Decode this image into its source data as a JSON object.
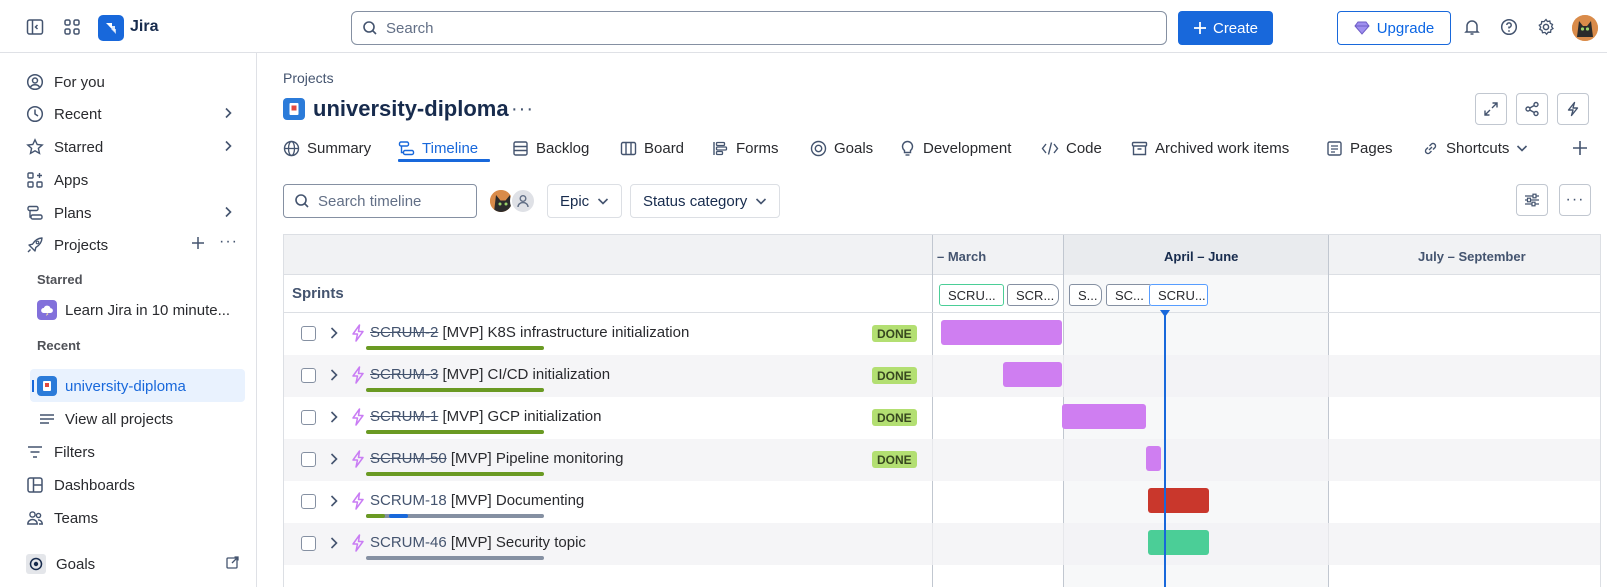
{
  "app": {
    "name": "Jira"
  },
  "top": {
    "search_placeholder": "Search",
    "create_label": "Create",
    "upgrade_label": "Upgrade",
    "brand_color": "#1868db"
  },
  "sidebar": {
    "for_you": "For you",
    "recent": "Recent",
    "starred": "Starred",
    "apps": "Apps",
    "plans": "Plans",
    "projects": "Projects",
    "starred_section": "Starred",
    "starred_project": "Learn Jira in 10 minute...",
    "recent_section": "Recent",
    "recent_project": "university-diploma",
    "view_all": "View all projects",
    "filters": "Filters",
    "dashboards": "Dashboards",
    "teams": "Teams",
    "goals": "Goals"
  },
  "page": {
    "breadcrumb": "Projects",
    "title": "university-diploma"
  },
  "tabs": [
    "Summary",
    "Timeline",
    "Backlog",
    "Board",
    "Forms",
    "Goals",
    "Development",
    "Code",
    "Archived work items",
    "Pages",
    "Shortcuts"
  ],
  "toolbar": {
    "search_placeholder": "Search timeline",
    "epic_label": "Epic",
    "status_label": "Status category"
  },
  "timeline": {
    "months": [
      "– March",
      "April – June",
      "July – September"
    ],
    "current_month": "April – June",
    "sprints_label": "Sprints",
    "sprints": [
      "SCRU...",
      "SCR...",
      "S...",
      "SC...",
      "SCRU..."
    ],
    "items": [
      {
        "key": "SCRUM-2",
        "title": "[MVP] K8S infrastructure initialization",
        "status": "DONE",
        "done": true,
        "bar_color": "#cf7ef1"
      },
      {
        "key": "SCRUM-3",
        "title": "[MVP] CI/CD initialization",
        "status": "DONE",
        "done": true,
        "bar_color": "#cf7ef1"
      },
      {
        "key": "SCRUM-1",
        "title": "[MVP] GCP initialization",
        "status": "DONE",
        "done": true,
        "bar_color": "#cf7ef1"
      },
      {
        "key": "SCRUM-50",
        "title": "[MVP] Pipeline monitoring",
        "status": "DONE",
        "done": true,
        "bar_color": "#cf7ef1"
      },
      {
        "key": "SCRUM-18",
        "title": "[MVP] Documenting",
        "status": "",
        "done": false,
        "bar_color": "#c9372c"
      },
      {
        "key": "SCRUM-46",
        "title": "[MVP] Security topic",
        "status": "",
        "done": false,
        "bar_color": "#4bce97"
      }
    ]
  }
}
